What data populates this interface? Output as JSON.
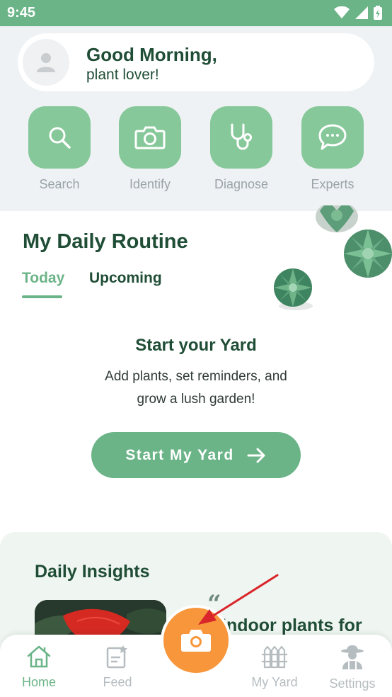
{
  "status_bar": {
    "time": "9:45"
  },
  "header": {
    "greeting": "Good Morning,",
    "subtitle": "plant lover!"
  },
  "quick_actions": [
    {
      "label": "Search",
      "icon": "search-icon"
    },
    {
      "label": "Identify",
      "icon": "camera-icon"
    },
    {
      "label": "Diagnose",
      "icon": "stethoscope-icon"
    },
    {
      "label": "Experts",
      "icon": "chat-icon"
    }
  ],
  "routine": {
    "title": "My Daily Routine",
    "tabs": [
      {
        "label": "Today",
        "active": true
      },
      {
        "label": "Upcoming",
        "active": false
      }
    ],
    "empty_title": "Start your Yard",
    "empty_desc": "Add plants, set reminders, and grow a lush garden!",
    "cta_label": "Start My Yard"
  },
  "insights": {
    "title": "Daily Insights",
    "quote_mark": "“",
    "headline": "Indoor plants for"
  },
  "bottom_nav": [
    {
      "label": "Home",
      "icon": "home-icon",
      "active": true
    },
    {
      "label": "Feed",
      "icon": "feed-icon",
      "active": false
    },
    {
      "label": "My Yard",
      "icon": "fence-icon",
      "active": false
    },
    {
      "label": "Settings",
      "icon": "gardener-icon",
      "active": false
    }
  ],
  "colors": {
    "brand_green": "#6bb488",
    "button_green": "#86c899",
    "dark_green": "#1f4d35",
    "camera_orange": "#f7963b",
    "annotation_red": "#d9262a"
  }
}
